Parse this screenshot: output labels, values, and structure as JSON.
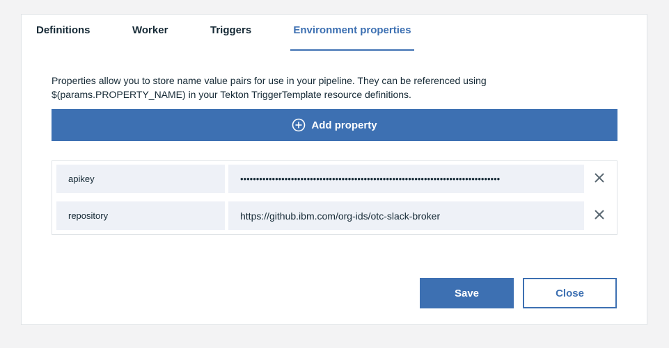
{
  "tabs": [
    {
      "label": "Definitions",
      "active": false
    },
    {
      "label": "Worker",
      "active": false
    },
    {
      "label": "Triggers",
      "active": false
    },
    {
      "label": "Environment properties",
      "active": true
    }
  ],
  "description": {
    "line1": "Properties allow you to store name value pairs for use in your pipeline. They can be referenced using",
    "line2": "$(params.PROPERTY_NAME) in your Tekton TriggerTemplate resource definitions."
  },
  "add_property": {
    "label": "Add property",
    "icon": "plus-circle-icon"
  },
  "properties": [
    {
      "name": "apikey",
      "value": "••••••••••••••••••••••••••••••••••••••••••••••••••••••••••••••••••••••••••••••••••",
      "secret": true,
      "remove_icon": "close-icon"
    },
    {
      "name": "repository",
      "value": "https://github.ibm.com/org-ids/otc-slack-broker",
      "secret": false,
      "remove_icon": "close-icon"
    }
  ],
  "actions": {
    "save_label": "Save",
    "close_label": "Close"
  },
  "colors": {
    "accent": "#3d70b2",
    "field_bg": "#eef1f7",
    "page_bg": "#f3f3f4",
    "text": "#152935"
  }
}
